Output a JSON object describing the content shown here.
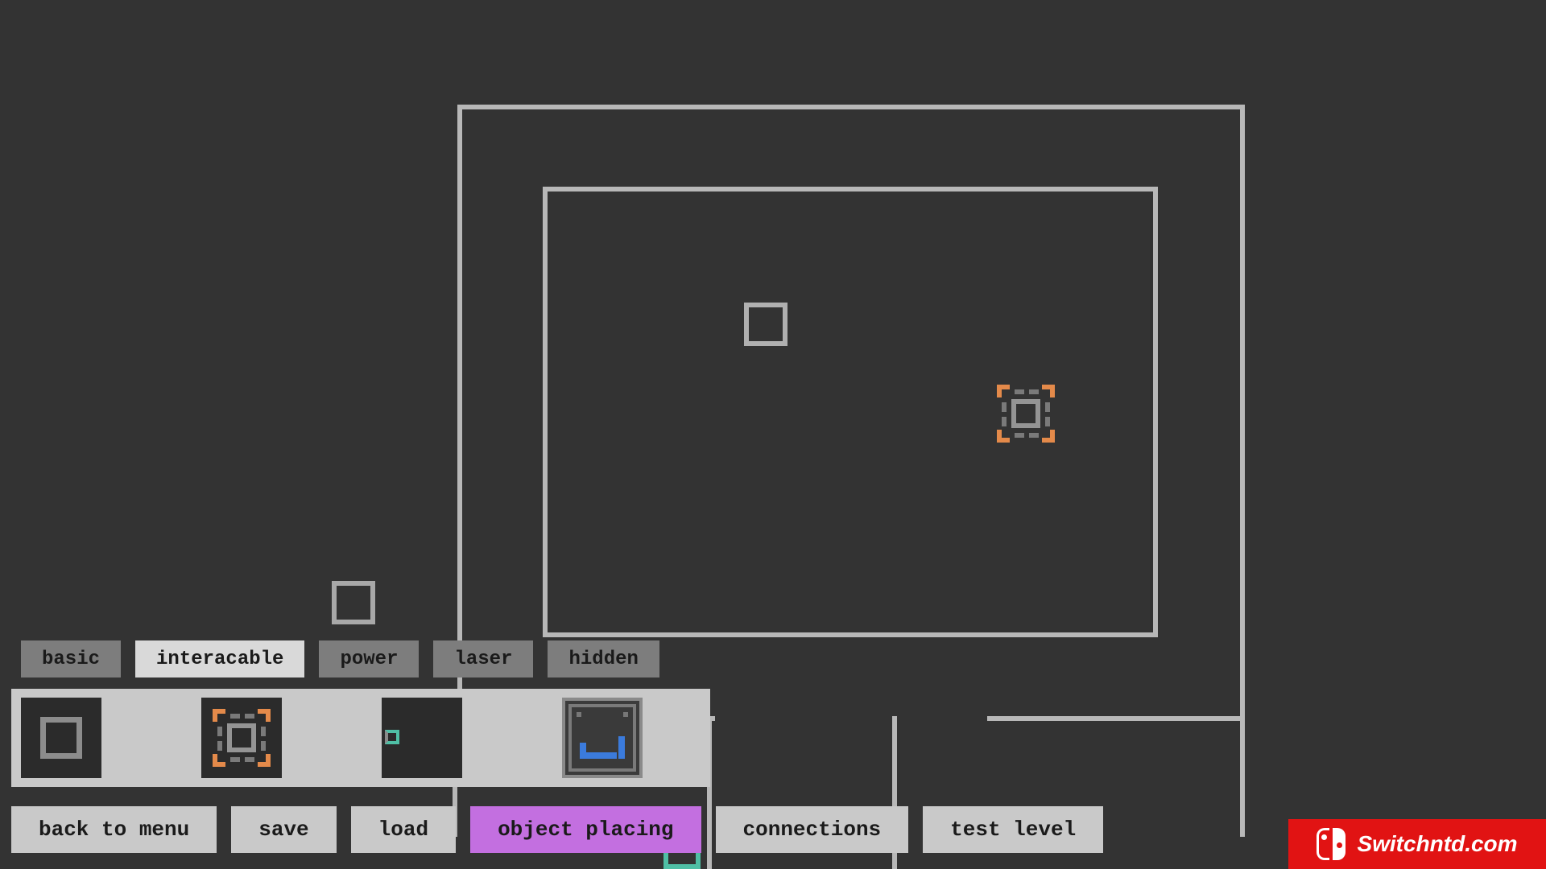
{
  "tabs": {
    "items": [
      {
        "id": "basic",
        "label": "basic",
        "active": false
      },
      {
        "id": "interacable",
        "label": "interacable",
        "active": true
      },
      {
        "id": "power",
        "label": "power",
        "active": false
      },
      {
        "id": "laser",
        "label": "laser",
        "active": false
      },
      {
        "id": "hidden",
        "label": "hidden",
        "active": false
      }
    ]
  },
  "palette": {
    "items": [
      {
        "id": "box",
        "icon": "box-icon",
        "selected": false
      },
      {
        "id": "selector",
        "icon": "selection-box-icon",
        "selected": false
      },
      {
        "id": "mini",
        "icon": "small-block-icon",
        "selected": false
      },
      {
        "id": "tray",
        "icon": "tray-icon",
        "selected": true
      }
    ]
  },
  "actions": {
    "back": "back to menu",
    "save": "save",
    "load": "load",
    "place": "object placing",
    "connect": "connections",
    "test": "test level"
  },
  "watermark": {
    "text": "Switchntd.com"
  },
  "canvas_objects": {
    "box": {
      "type": "box"
    },
    "selected": {
      "type": "selection-box"
    },
    "stray": {
      "type": "box"
    },
    "teal": {
      "type": "bracket"
    }
  }
}
